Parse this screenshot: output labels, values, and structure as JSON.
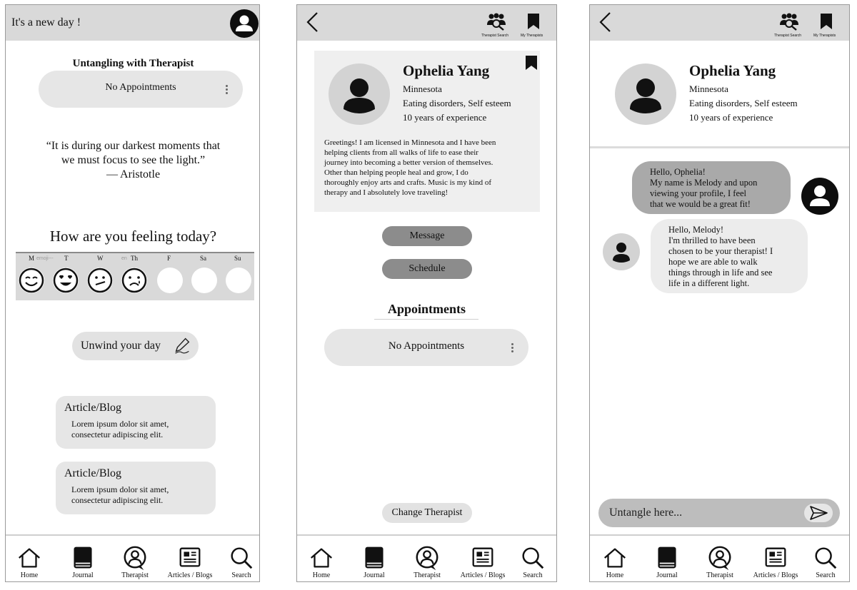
{
  "screen1": {
    "greeting": "It's a new day !",
    "section_title": "Untangling with Therapist",
    "appointment_status": "No Appointments",
    "quote_line1": "“It is during our darkest moments that",
    "quote_line2": "we must focus to see the light.”",
    "quote_author": "— Aristotle",
    "feeling_title": "How are you feeling today?",
    "days": [
      {
        "label": "M",
        "mood": "happy"
      },
      {
        "label": "T",
        "mood": "love"
      },
      {
        "label": "W",
        "mood": "meh"
      },
      {
        "label": "Th",
        "mood": "sad"
      },
      {
        "label": "F",
        "mood": "none"
      },
      {
        "label": "Sa",
        "mood": "none"
      },
      {
        "label": "Su",
        "mood": "none"
      }
    ],
    "emoji_note_1": "emoji---",
    "emoji_note_2": "en",
    "unwind_label": "Unwind your day",
    "articles": [
      {
        "title": "Article/Blog",
        "line1": "Lorem ipsum dolor sit amet,",
        "line2": "consectetur adipiscing elit."
      },
      {
        "title": "Article/Blog",
        "line1": "Lorem ipsum dolor sit amet,",
        "line2": "consectetur adipiscing elit."
      }
    ]
  },
  "header_icons": {
    "therapist_search": "Therapist Search",
    "my_therapists": "My Therapists"
  },
  "therapist": {
    "name": "Ophelia Yang",
    "location": "Minnesota",
    "specialties": "Eating disorders, Self esteem",
    "experience": "10 years of experience",
    "bio_lines": [
      "Greetings! I am licensed in Minnesota and I have been",
      "helping clients from all walks of life to ease their",
      "journey into becoming a better version of themselves.",
      "Other than helping people heal and grow, I do",
      "thoroughly enjoy arts and crafts. Music is my kind of",
      "therapy and I absolutely love traveling!"
    ]
  },
  "screen2": {
    "message_label": "Message",
    "schedule_label": "Schedule",
    "appointments_title": "Appointments",
    "appointment_status": "No Appointments",
    "change_label": "Change Therapist"
  },
  "chat": {
    "user_message_lines": [
      "Hello, Ophelia!",
      "My name is Melody and upon",
      "viewing your profile, I feel",
      "that we would be a great fit!"
    ],
    "therapist_message_lines": [
      "Hello, Melody!",
      "I'm thrilled to have been",
      "chosen to be your therapist! I",
      "hope we are able to walk",
      "things through in life and see",
      "life in a different light."
    ],
    "input_placeholder": "Untangle here..."
  },
  "nav": [
    "Home",
    "Journal",
    "Therapist",
    "Articles / Blogs",
    "Search"
  ],
  "colors": {
    "header_bg": "#d9d9d9",
    "pill_bg": "#e6e6e6",
    "button_dark": "#8c8c8c",
    "avatar_dark": "#0d0d0d"
  }
}
